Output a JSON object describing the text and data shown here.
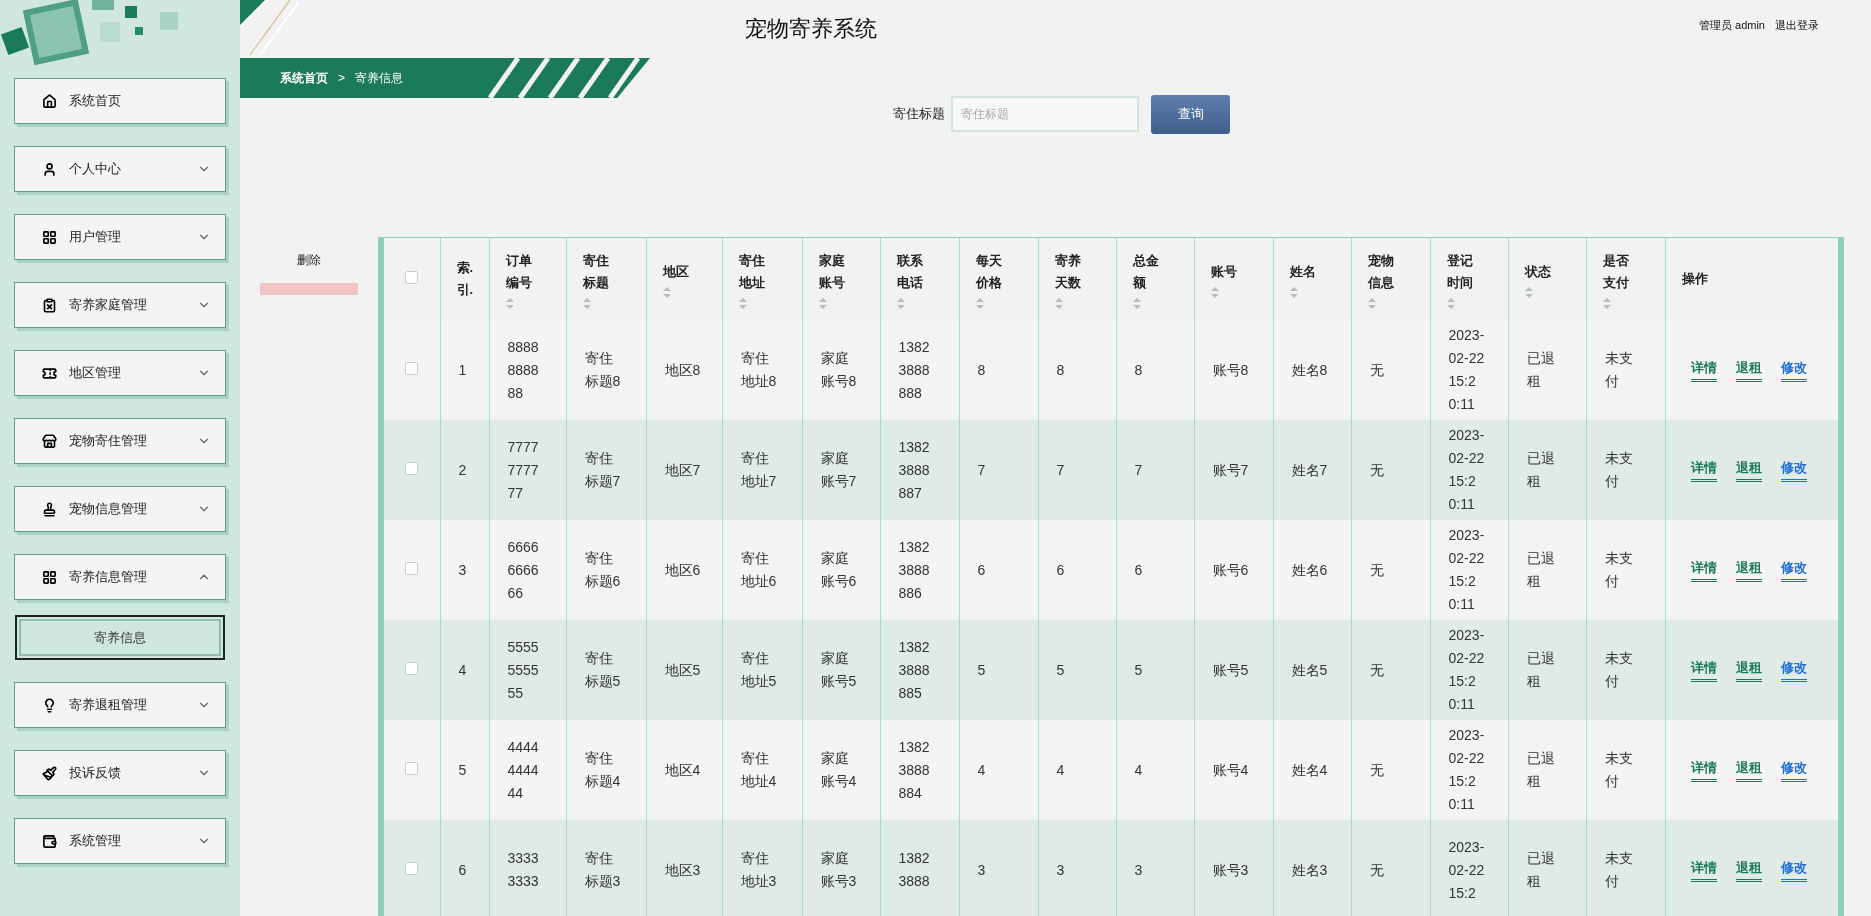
{
  "header": {
    "title": "宠物寄养系统",
    "user": "管理员 admin",
    "logout": "退出登录"
  },
  "sidebar": {
    "items": [
      {
        "label": "系统首页",
        "expandable": false
      },
      {
        "label": "个人中心",
        "expandable": true,
        "expanded": false
      },
      {
        "label": "用户管理",
        "expandable": true,
        "expanded": false
      },
      {
        "label": "寄养家庭管理",
        "expandable": true,
        "expanded": false
      },
      {
        "label": "地区管理",
        "expandable": true,
        "expanded": false
      },
      {
        "label": "宠物寄住管理",
        "expandable": true,
        "expanded": false
      },
      {
        "label": "宠物信息管理",
        "expandable": true,
        "expanded": false
      },
      {
        "label": "寄养信息管理",
        "expandable": true,
        "expanded": true,
        "children": [
          {
            "label": "寄养信息",
            "selected": true
          }
        ]
      },
      {
        "label": "寄养退租管理",
        "expandable": true,
        "expanded": false
      },
      {
        "label": "投诉反馈",
        "expandable": true,
        "expanded": false
      },
      {
        "label": "系统管理",
        "expandable": true,
        "expanded": false
      }
    ]
  },
  "breadcrumb": [
    "系统首页",
    ">",
    "寄养信息"
  ],
  "search": {
    "label": "寄住标题",
    "placeholder": "寄住标题",
    "button": "查询"
  },
  "delete_button": "删除",
  "table": {
    "select_all_checked": false,
    "columns": [
      {
        "label": "索.引.",
        "sortable": false
      },
      {
        "label": "订单编号",
        "sortable": true
      },
      {
        "label": "寄住标题",
        "sortable": true
      },
      {
        "label": "地区",
        "sortable": true
      },
      {
        "label": "寄住地址",
        "sortable": true
      },
      {
        "label": "家庭账号",
        "sortable": true
      },
      {
        "label": "联系电话",
        "sortable": true
      },
      {
        "label": "每天价格",
        "sortable": true
      },
      {
        "label": "寄养天数",
        "sortable": true
      },
      {
        "label": "总金额",
        "sortable": true
      },
      {
        "label": "账号",
        "sortable": true
      },
      {
        "label": "姓名",
        "sortable": true
      },
      {
        "label": "宠物信息",
        "sortable": true
      },
      {
        "label": "登记时间",
        "sortable": true
      },
      {
        "label": "状态",
        "sortable": true
      },
      {
        "label": "是否支付",
        "sortable": true
      },
      {
        "label": "操作",
        "sortable": false
      }
    ],
    "rows": [
      {
        "checked": false,
        "cells": [
          "1",
          "8888888888",
          "寄住标题8",
          "地区8",
          "寄住地址8",
          "家庭账号8",
          "13823888888",
          "8",
          "8",
          "8",
          "账号8",
          "姓名8",
          "无",
          "2023-02-22 15:20:11",
          "已退租",
          "未支付"
        ],
        "actions": [
          {
            "label": "详情",
            "color": "#1b7a5c"
          },
          {
            "label": "退租",
            "color": "#1b7a5c"
          },
          {
            "label": "修改",
            "color": "#1e6fd6"
          }
        ]
      },
      {
        "checked": false,
        "cells": [
          "2",
          "7777777777",
          "寄住标题7",
          "地区7",
          "寄住地址7",
          "家庭账号7",
          "13823888887",
          "7",
          "7",
          "7",
          "账号7",
          "姓名7",
          "无",
          "2023-02-22 15:20:11",
          "已退租",
          "未支付"
        ],
        "actions": [
          {
            "label": "详情",
            "color": "#1b7a5c"
          },
          {
            "label": "退租",
            "color": "#1b7a5c"
          },
          {
            "label": "修改",
            "color": "#1e6fd6"
          }
        ]
      },
      {
        "checked": false,
        "cells": [
          "3",
          "6666666666",
          "寄住标题6",
          "地区6",
          "寄住地址6",
          "家庭账号6",
          "13823888886",
          "6",
          "6",
          "6",
          "账号6",
          "姓名6",
          "无",
          "2023-02-22 15:20:11",
          "已退租",
          "未支付"
        ],
        "actions": [
          {
            "label": "详情",
            "color": "#1b7a5c"
          },
          {
            "label": "退租",
            "color": "#1b7a5c"
          },
          {
            "label": "修改",
            "color": "#1e6fd6"
          }
        ]
      },
      {
        "checked": false,
        "cells": [
          "4",
          "5555555555",
          "寄住标题5",
          "地区5",
          "寄住地址5",
          "家庭账号5",
          "13823888885",
          "5",
          "5",
          "5",
          "账号5",
          "姓名5",
          "无",
          "2023-02-22 15:20:11",
          "已退租",
          "未支付"
        ],
        "actions": [
          {
            "label": "详情",
            "color": "#1b7a5c"
          },
          {
            "label": "退租",
            "color": "#1b7a5c"
          },
          {
            "label": "修改",
            "color": "#1e6fd6"
          }
        ]
      },
      {
        "checked": false,
        "cells": [
          "5",
          "4444444444",
          "寄住标题4",
          "地区4",
          "寄住地址4",
          "家庭账号4",
          "13823888884",
          "4",
          "4",
          "4",
          "账号4",
          "姓名4",
          "无",
          "2023-02-22 15:20:11",
          "已退租",
          "未支付"
        ],
        "actions": [
          {
            "label": "详情",
            "color": "#1b7a5c"
          },
          {
            "label": "退租",
            "color": "#1b7a5c"
          },
          {
            "label": "修改",
            "color": "#1e6fd6"
          }
        ]
      },
      {
        "checked": false,
        "cells": [
          "6",
          "33333333",
          "寄住标题3",
          "地区3",
          "寄住地址3",
          "家庭账号3",
          "13823888",
          "3",
          "3",
          "3",
          "账号3",
          "姓名3",
          "无",
          "2023-02-22 15:2",
          "已退租",
          "未支付"
        ],
        "actions": [
          {
            "label": "详情",
            "color": "#1b7a5c"
          },
          {
            "label": "退租",
            "color": "#1b7a5c"
          },
          {
            "label": "修改",
            "color": "#1e6fd6"
          }
        ]
      }
    ]
  }
}
